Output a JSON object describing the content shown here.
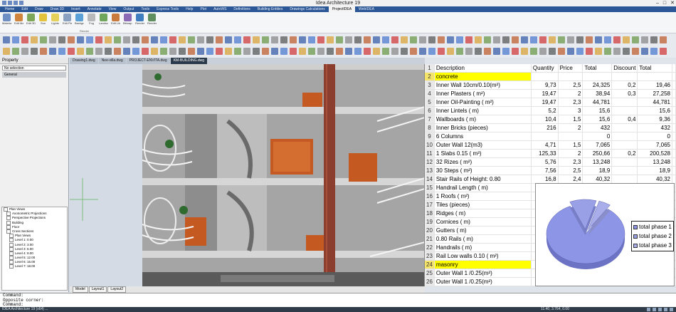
{
  "window": {
    "title": "Idea Architecture 19"
  },
  "menu": [
    "Home",
    "Edit",
    "Draw",
    "Draw 3D",
    "Insert",
    "Annotate",
    "View",
    "Output",
    "Tools",
    "Express Tools",
    "Help",
    "Plot",
    "AutoWS",
    "Definitions",
    "Building Entities",
    "Drawings Calculations",
    "ProjectIDEA",
    "WebIDEA"
  ],
  "menu_active_index": 16,
  "ribbon": {
    "buttons": [
      "Material Library",
      "Edit Materials",
      "Edit 3D Objects",
      "Sun",
      "Lights",
      "Edit Placement",
      "Background",
      "Fog",
      "Landscape Objects",
      "Edit Library Objects",
      "Bitmap Library",
      "Render",
      "Render Outline"
    ],
    "group_label": "Render"
  },
  "doc_tabs": [
    "Drawing1.dwg",
    "Nee-villa.dwg",
    "PROJECT-ENVITA.dwg",
    "KM-BUILDING.dwg"
  ],
  "doc_tab_active": 3,
  "layout_tabs": [
    "Model",
    "Layout1",
    "Layout2"
  ],
  "sidebar": {
    "title": "Property",
    "select_value": "No selection",
    "section": "General",
    "tree": [
      "Plan Views",
      "Axonometric Projections",
      "Perspective Projections",
      "Building",
      "Floor",
      "Cross Sections",
      "Plan Views",
      "Level 1: 0.00",
      "Level 2: 3.00",
      "Level 3: 6.00",
      "Level 4: 9.00",
      "Level 5: 12.00",
      "Level 6: 15.00",
      "Level 7: 18.00"
    ]
  },
  "sheet": {
    "headers": [
      "Description",
      "Quantity",
      "Price",
      "Total",
      "Discount",
      "Total"
    ],
    "rows": [
      {
        "n": "1",
        "desc": "Description",
        "qty": "Quantity",
        "price": "Price",
        "total": "Total",
        "disc": "Discount",
        "total2": "Total",
        "hl": false
      },
      {
        "n": "2",
        "desc": "concrete",
        "qty": "",
        "price": "",
        "total": "",
        "disc": "",
        "total2": "",
        "hl": true
      },
      {
        "n": "3",
        "desc": "Inner Wall 10cm/0.10(m²)",
        "qty": "9,73",
        "price": "2,5",
        "total": "24,325",
        "disc": "0,2",
        "total2": "19,46",
        "hl": false
      },
      {
        "n": "4",
        "desc": "Inner Plasters ( m²)",
        "qty": "19,47",
        "price": "2",
        "total": "38,94",
        "disc": "0,3",
        "total2": "27,258",
        "hl": false
      },
      {
        "n": "5",
        "desc": "Inner Oil-Painting ( m²)",
        "qty": "19,47",
        "price": "2,3",
        "total": "44,781",
        "disc": "",
        "total2": "44,781",
        "hl": false
      },
      {
        "n": "6",
        "desc": "Inner Lintels ( m)",
        "qty": "5,2",
        "price": "3",
        "total": "15,6",
        "disc": "",
        "total2": "15,6",
        "hl": false
      },
      {
        "n": "7",
        "desc": "Wallboards ( m)",
        "qty": "10,4",
        "price": "1,5",
        "total": "15,6",
        "disc": "0,4",
        "total2": "9,36",
        "hl": false
      },
      {
        "n": "8",
        "desc": "Inner Bricks (pieces)",
        "qty": "216",
        "price": "2",
        "total": "432",
        "disc": "",
        "total2": "432",
        "hl": false
      },
      {
        "n": "9",
        "desc": "6 Columns",
        "qty": "",
        "price": "",
        "total": "0",
        "disc": "",
        "total2": "0",
        "hl": false
      },
      {
        "n": "10",
        "desc": "Outer Wall 12(m3)",
        "qty": "4,71",
        "price": "1,5",
        "total": "7,065",
        "disc": "",
        "total2": "7,065",
        "hl": false
      },
      {
        "n": "11",
        "desc": "1 Slabs 0.15 ( m³)",
        "qty": "125,33",
        "price": "2",
        "total": "250,66",
        "disc": "0,2",
        "total2": "200,528",
        "hl": false
      },
      {
        "n": "12",
        "desc": "32 Rizes ( m²)",
        "qty": "5,76",
        "price": "2,3",
        "total": "13,248",
        "disc": "",
        "total2": "13,248",
        "hl": false
      },
      {
        "n": "13",
        "desc": "30 Steps ( m²)",
        "qty": "7,56",
        "price": "2,5",
        "total": "18,9",
        "disc": "",
        "total2": "18,9",
        "hl": false
      },
      {
        "n": "14",
        "desc": "Stair Rails of Height: 0.80",
        "qty": "16,8",
        "price": "2,4",
        "total": "40,32",
        "disc": "",
        "total2": "40,32",
        "hl": false
      },
      {
        "n": "15",
        "desc": "Handrail Length ( m)",
        "qty": "20,26",
        "price": "1,6",
        "total": "32,416",
        "disc": "",
        "total2": "32,416",
        "hl": false
      },
      {
        "n": "16",
        "desc": "1 Roofs ( m²)",
        "qty": "",
        "price": "",
        "total": "",
        "disc": "",
        "total2": "",
        "hl": false
      },
      {
        "n": "17",
        "desc": "Tiles (pieces)",
        "qty": "",
        "price": "",
        "total": "",
        "disc": "",
        "total2": "",
        "hl": false
      },
      {
        "n": "18",
        "desc": "Ridges ( m)",
        "qty": "",
        "price": "",
        "total": "",
        "disc": "",
        "total2": "",
        "hl": false
      },
      {
        "n": "19",
        "desc": "Cornices ( m)",
        "qty": "",
        "price": "",
        "total": "",
        "disc": "",
        "total2": "",
        "hl": false
      },
      {
        "n": "20",
        "desc": "Gutters ( m)",
        "qty": "",
        "price": "",
        "total": "",
        "disc": "",
        "total2": "",
        "hl": false
      },
      {
        "n": "21",
        "desc": "0.80 Rails ( m)",
        "qty": "",
        "price": "",
        "total": "",
        "disc": "",
        "total2": "",
        "hl": false
      },
      {
        "n": "22",
        "desc": "Handrails ( m)",
        "qty": "",
        "price": "",
        "total": "",
        "disc": "",
        "total2": "",
        "hl": false
      },
      {
        "n": "23",
        "desc": "Rail Low walls 0.10 ( m²)",
        "qty": "",
        "price": "",
        "total": "",
        "disc": "",
        "total2": "",
        "hl": false
      },
      {
        "n": "24",
        "desc": "masonry",
        "qty": "",
        "price": "",
        "total": "",
        "disc": "",
        "total2": "",
        "hl": true
      },
      {
        "n": "25",
        "desc": "Outer Wall 1 /0.25(m²)",
        "qty": "",
        "price": "",
        "total": "",
        "disc": "",
        "total2": "",
        "hl": false
      },
      {
        "n": "26",
        "desc": "Outer Wall 1 /0.25(m²)",
        "qty": "",
        "price": "",
        "total": "",
        "disc": "",
        "total2": "",
        "hl": false
      },
      {
        "n": "27",
        "desc": "Inner Wall 10cm/0.10(m²)",
        "qty": "",
        "price": "",
        "total": "",
        "disc": "",
        "total2": "",
        "hl": false
      },
      {
        "n": "28",
        "desc": "Inner Wall 10cm/0.25(m²)",
        "qty": "",
        "price": "",
        "total": "",
        "disc": "",
        "total2": "",
        "hl": false
      },
      {
        "n": "29",
        "desc": "Inner Wall 10cm/0.20(m²)",
        "qty": "",
        "price": "",
        "total": "",
        "disc": "",
        "total2": "",
        "hl": false
      }
    ]
  },
  "chart_data": {
    "type": "pie",
    "categories": [
      "total phase 1",
      "total phase 2",
      "total phase 3"
    ],
    "values": [
      84,
      11,
      5
    ],
    "legend_placement": "right",
    "colors": [
      "#8d95e6",
      "#9aa0e6",
      "#a9aeea"
    ]
  },
  "command": {
    "lines": [
      "Command:",
      "Opposite corner:",
      "Command:"
    ]
  },
  "status": {
    "left": "IDEA Architecture 19 (x64) ...",
    "coords": "11.40, 3.764, 0.00"
  },
  "accent": "#2b5797",
  "highlight": "#ffff00"
}
